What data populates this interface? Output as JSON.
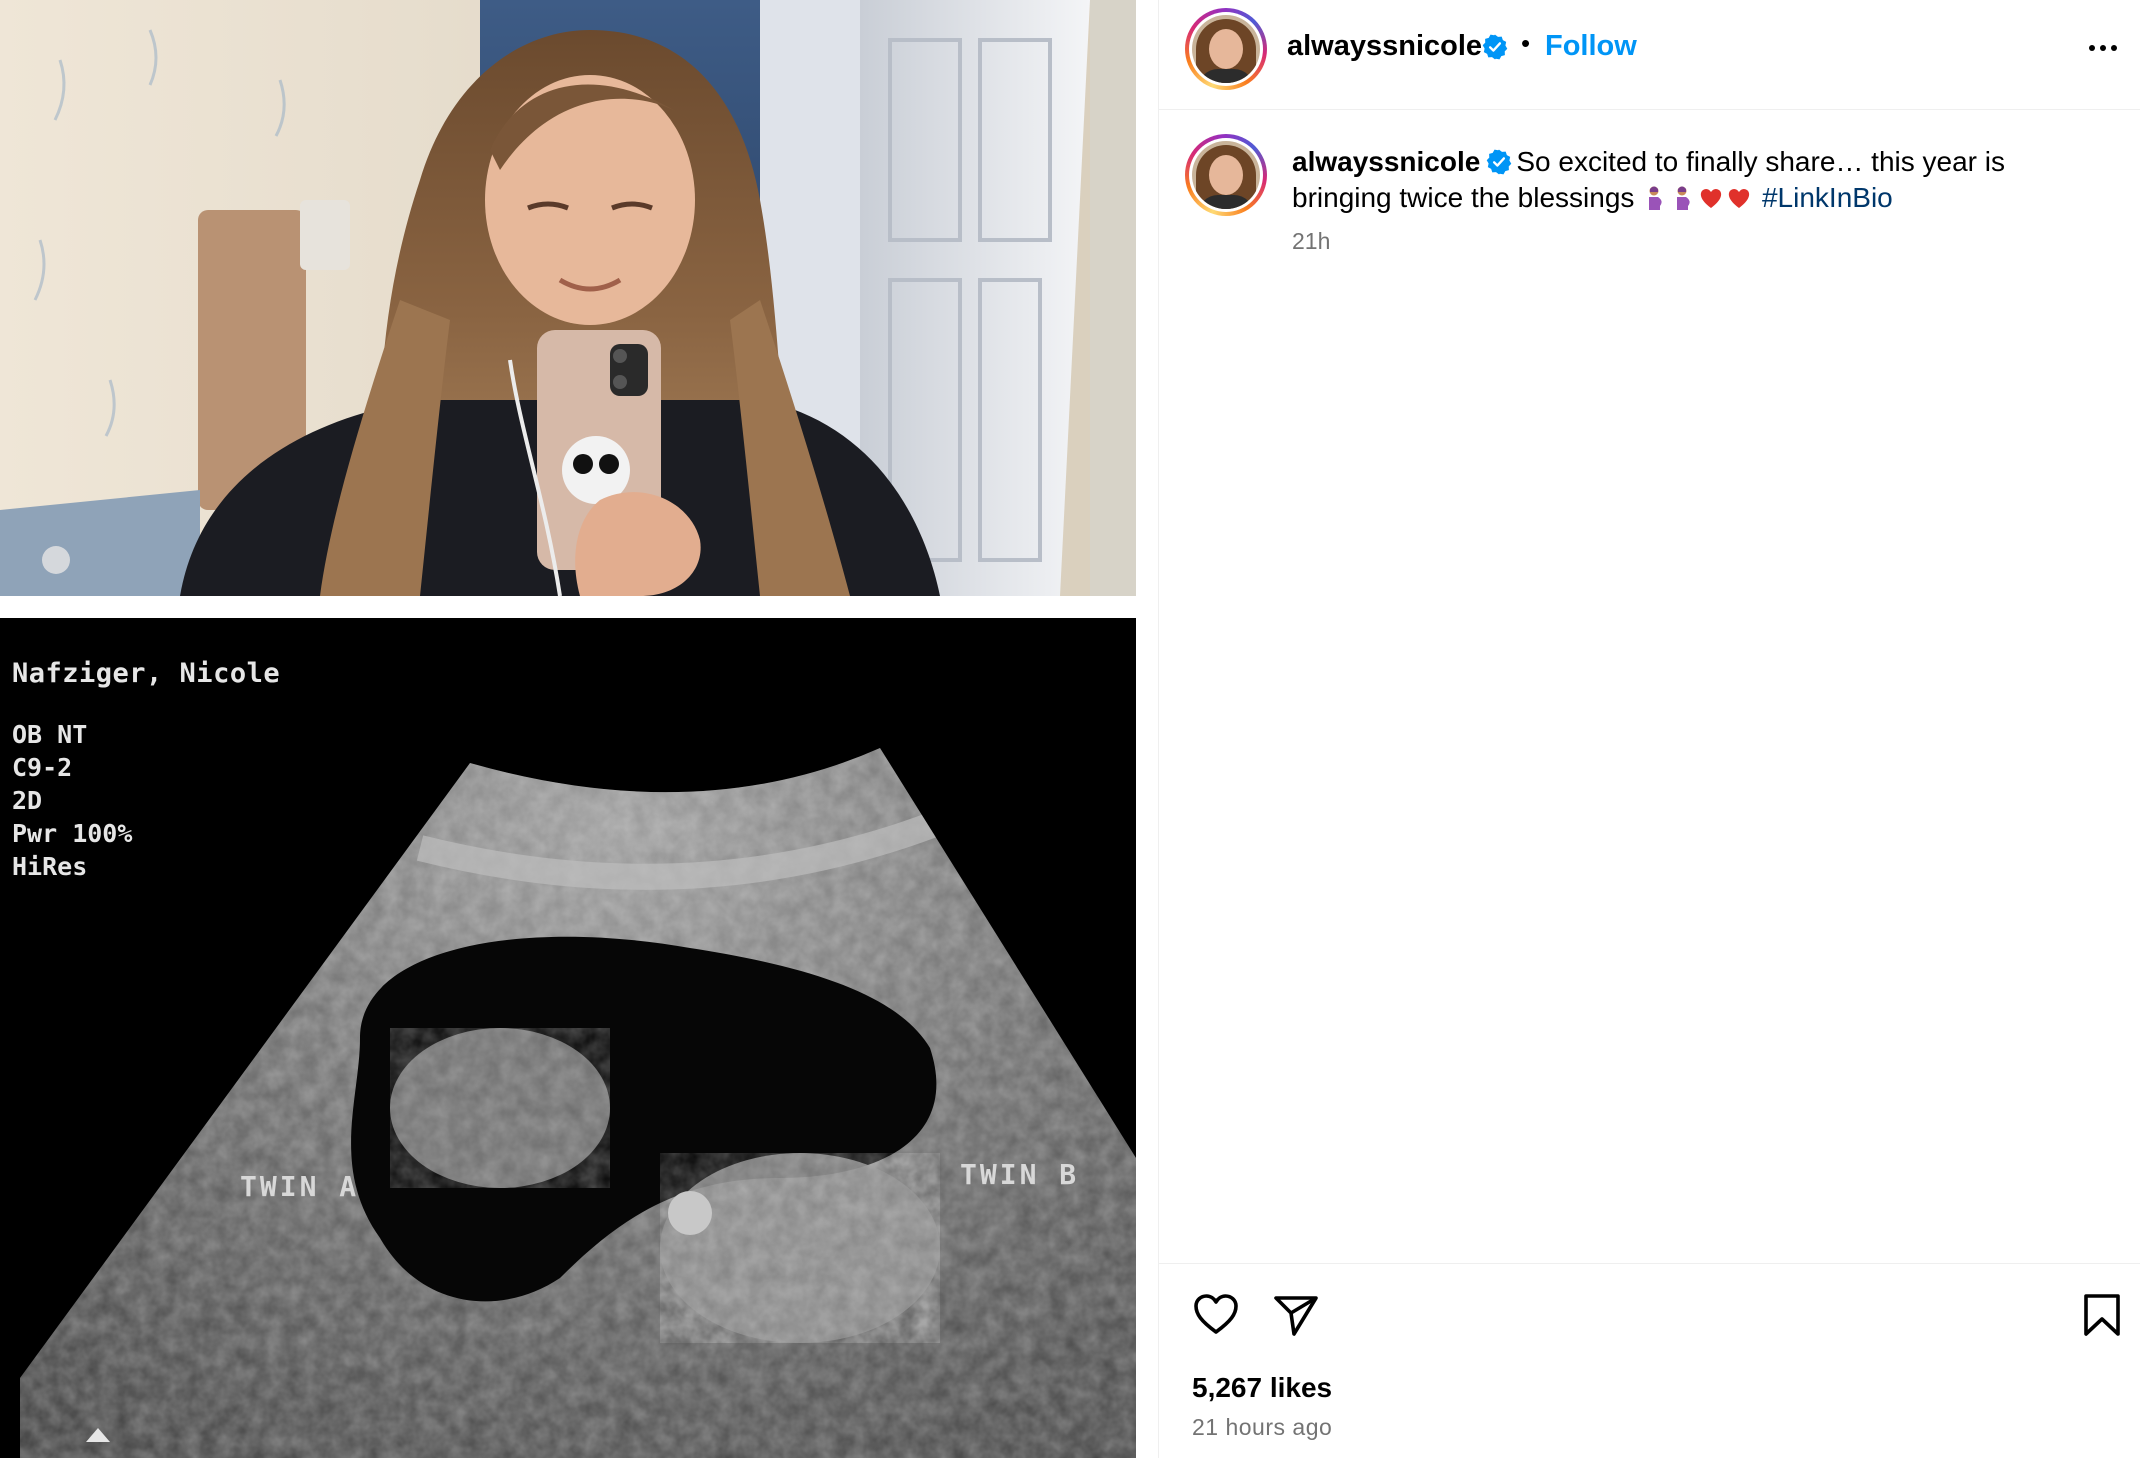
{
  "post": {
    "username": "alwayssnicole",
    "verified": true,
    "follow_label": "Follow",
    "separator": "•",
    "caption_text": "So excited to finally share… this year is bringing twice the blessings",
    "caption_emojis": [
      "pregnant-woman",
      "pregnant-woman",
      "red-heart",
      "red-heart"
    ],
    "hashtag": "#LinkInBio",
    "caption_time": "21h",
    "likes": "5,267 likes",
    "posted_ago": "21 hours ago"
  },
  "media": {
    "ultrasound": {
      "patient_name": "Nafziger, Nicole",
      "params": [
        "OB NT",
        "C9-2",
        "2D",
        "Pwr 100%",
        "HiRes"
      ],
      "label_twin_a": "TWIN A",
      "label_twin_b": "TWIN B"
    }
  },
  "icons": [
    "verified-badge-icon",
    "more-options-icon",
    "heart-icon",
    "send-icon",
    "bookmark-icon"
  ],
  "colors": {
    "follow_blue": "#0095f6",
    "hashtag_blue": "#00376b",
    "verified_blue": "#0095f6",
    "muted_text": "#737373",
    "border": "#efefef"
  }
}
